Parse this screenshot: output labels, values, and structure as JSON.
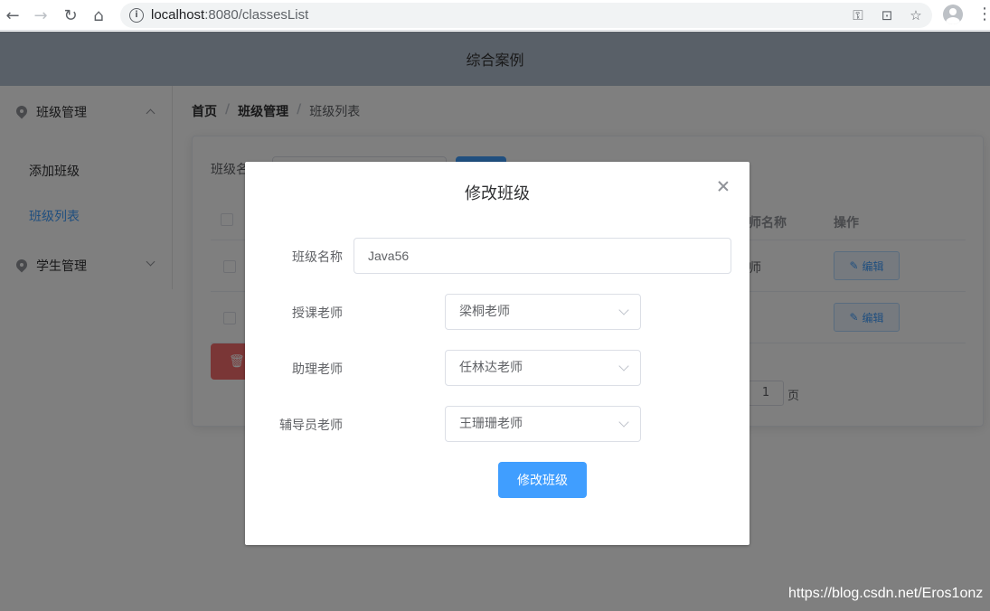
{
  "browser": {
    "url_host": "localhost",
    "url_rest": ":8080/classesList"
  },
  "app": {
    "header_title": "综合案例"
  },
  "sidebar": {
    "groups": [
      {
        "label": "班级管理",
        "expanded": true,
        "items": [
          {
            "label": "添加班级",
            "active": false
          },
          {
            "label": "班级列表",
            "active": true
          }
        ]
      },
      {
        "label": "学生管理",
        "expanded": false,
        "items": []
      }
    ]
  },
  "breadcrumb": [
    "首页",
    "班级管理",
    "班级列表"
  ],
  "list": {
    "search_label": "班级名",
    "columns": [
      "师名称",
      "操作"
    ],
    "rows": [
      {
        "teacher_fragment": "师",
        "edit_label": "编辑"
      },
      {
        "teacher_fragment": "",
        "edit_label": "编辑"
      }
    ],
    "page_value": "1",
    "page_suffix": "页"
  },
  "dialog": {
    "title": "修改班级",
    "fields": {
      "class_name": {
        "label": "班级名称",
        "value": "Java56"
      },
      "teacher": {
        "label": "授课老师",
        "value": "梁桐老师"
      },
      "assistant": {
        "label": "助理老师",
        "value": "任林达老师"
      },
      "counselor": {
        "label": "辅导员老师",
        "value": "王珊珊老师"
      }
    },
    "submit_label": "修改班级"
  },
  "watermark": "https://blog.csdn.net/Eros1onz",
  "colors": {
    "primary": "#409eff",
    "header_bg": "#b3c0d1",
    "danger": "#f56c6c"
  }
}
